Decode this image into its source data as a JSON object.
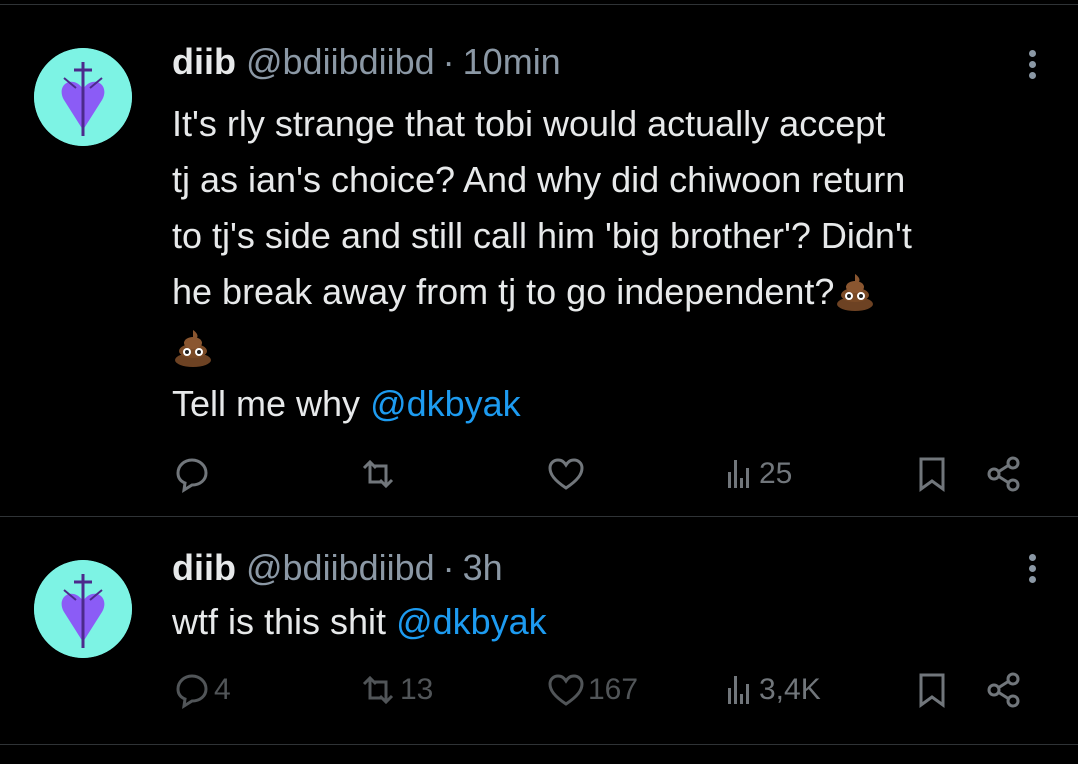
{
  "tweets": [
    {
      "name": "diib",
      "handle": "@bdiibdiibd",
      "separator": "·",
      "time": "10min",
      "lines": [
        "It's rly strange that tobi would actually accept",
        "tj as ian's choice? And why did chiwoon return",
        "to tj's side and still call him 'big brother'? Didn't",
        "he break away from tj to go independent?"
      ],
      "emoji_icon": "pile-of-poo-emoji",
      "closing_text": "Tell me why ",
      "mention": "@dkbyak",
      "counts": {
        "replies": "",
        "reposts": "",
        "likes": "",
        "views": "25"
      }
    },
    {
      "name": "diib",
      "handle": "@bdiibdiibd",
      "separator": "·",
      "time": "3h",
      "text": "wtf is this shit ",
      "mention": "@dkbyak",
      "counts": {
        "replies": "4",
        "reposts": "13",
        "likes": "167",
        "views": "3,4K"
      }
    }
  ],
  "colors": {
    "background": "#000000",
    "text": "#e7e9ea",
    "muted": "#8b98a5",
    "link": "#1d9bf0",
    "avatar_bg": "#7df3e4",
    "avatar_heart": "#8b5cf6"
  },
  "icons": [
    "reply-icon",
    "repost-icon",
    "like-icon",
    "views-icon",
    "bookmark-icon",
    "share-icon",
    "more-options-icon"
  ]
}
